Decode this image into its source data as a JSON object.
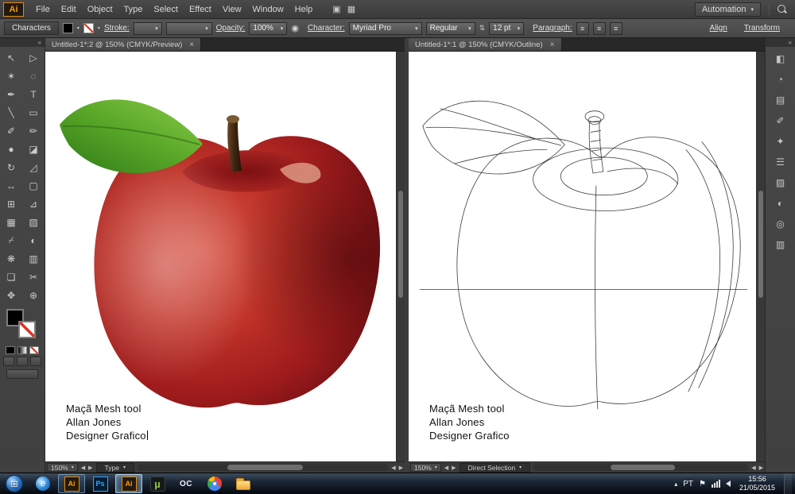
{
  "app": {
    "logo": "Ai",
    "menus": [
      "File",
      "Edit",
      "Object",
      "Type",
      "Select",
      "Effect",
      "View",
      "Window",
      "Help"
    ],
    "workspace_label": "Automation"
  },
  "ui": {
    "dropdown": "▾",
    "close": "×",
    "collapse": "«",
    "chevron_left": "◀",
    "chevron_right": "▶",
    "tray_arrow": "▴",
    "flag": "⚑",
    "stepper": "⇅",
    "align_glyph": "≡",
    "recolor_glyph": "◉",
    "screen_mode_glyph": "▣",
    "arrange_glyph": "▦",
    "start_flag": "⊞"
  },
  "control_bar": {
    "characters_label": "Characters",
    "stroke_label": "Stroke:",
    "opacity_label": "Opacity:",
    "opacity_value": "100%",
    "character_label": "Character:",
    "font_family": "Myriad Pro",
    "font_style": "Regular",
    "font_size": "12 pt",
    "paragraph_label": "Paragraph:",
    "align_label": "Align",
    "transform_label": "Transform"
  },
  "toolbar": {
    "tools": [
      {
        "name": "selection",
        "glyph": "↖"
      },
      {
        "name": "direct-selection",
        "glyph": "▷"
      },
      {
        "name": "magic-wand",
        "glyph": "✶"
      },
      {
        "name": "lasso",
        "glyph": "◌"
      },
      {
        "name": "pen",
        "glyph": "✒"
      },
      {
        "name": "type",
        "glyph": "T"
      },
      {
        "name": "line-segment",
        "glyph": "╲"
      },
      {
        "name": "rectangle",
        "glyph": "▭"
      },
      {
        "name": "paintbrush",
        "glyph": "✐"
      },
      {
        "name": "pencil",
        "glyph": "✏"
      },
      {
        "name": "blob-brush",
        "glyph": "●"
      },
      {
        "name": "eraser",
        "glyph": "◪"
      },
      {
        "name": "rotate",
        "glyph": "↻"
      },
      {
        "name": "scale",
        "glyph": "◿"
      },
      {
        "name": "width",
        "glyph": "↔"
      },
      {
        "name": "free-transform",
        "glyph": "▢"
      },
      {
        "name": "shape-builder",
        "glyph": "⊞"
      },
      {
        "name": "perspective-grid",
        "glyph": "⊿"
      },
      {
        "name": "mesh",
        "glyph": "▦"
      },
      {
        "name": "gradient",
        "glyph": "▨"
      },
      {
        "name": "eyedropper",
        "glyph": "⌿"
      },
      {
        "name": "blend",
        "glyph": "◐"
      },
      {
        "name": "symbol-sprayer",
        "glyph": "❋"
      },
      {
        "name": "column-graph",
        "glyph": "▥"
      },
      {
        "name": "artboard",
        "glyph": "❏"
      },
      {
        "name": "slice",
        "glyph": "✂"
      },
      {
        "name": "hand",
        "glyph": "✥"
      },
      {
        "name": "zoom",
        "glyph": "⊕"
      }
    ]
  },
  "dock": {
    "panels": [
      {
        "name": "color",
        "glyph": "◧"
      },
      {
        "name": "color-guide",
        "glyph": "◔"
      },
      {
        "name": "swatches",
        "glyph": "▤"
      },
      {
        "name": "brushes",
        "glyph": "✐"
      },
      {
        "name": "symbols",
        "glyph": "✦"
      },
      {
        "name": "stroke",
        "glyph": "☰"
      },
      {
        "name": "gradient",
        "glyph": "▨"
      },
      {
        "name": "transparency",
        "glyph": "◐"
      },
      {
        "name": "appearance",
        "glyph": "◎"
      },
      {
        "name": "layers",
        "glyph": "▥"
      }
    ]
  },
  "documents": {
    "left": {
      "tab_title": "Untitled-1*:2 @ 150% (CMYK/Preview)",
      "zoom": "150%",
      "status_tool": "Type",
      "artboard_text": [
        "Maçã Mesh tool",
        "Allan Jones",
        "Designer Grafico"
      ]
    },
    "right": {
      "tab_title": "Untitled-1*:1 @ 150% (CMYK/Outline)",
      "zoom": "150%",
      "status_tool": "Direct Selection",
      "artboard_text": [
        "Maçã Mesh tool",
        "Allan Jones",
        "Designer Grafico"
      ]
    }
  },
  "taskbar": {
    "icons": [
      {
        "name": "internet-browser",
        "label": "e"
      },
      {
        "name": "illustrator",
        "label": "Ai"
      },
      {
        "name": "photoshop",
        "label": "Ps"
      },
      {
        "name": "illustrator-2",
        "label": "Ai"
      },
      {
        "name": "utorrent",
        "label": "µ"
      },
      {
        "name": "openoffice",
        "label": "OC"
      }
    ],
    "tray": {
      "lang": "PT",
      "time": "15:56",
      "date": "21/05/2015"
    }
  },
  "colors": {
    "apple_red": "#b52a25",
    "leaf_green": "#5aa827",
    "ui_dark": "#3c3c3c",
    "accent_orange": "#ff9a00"
  }
}
